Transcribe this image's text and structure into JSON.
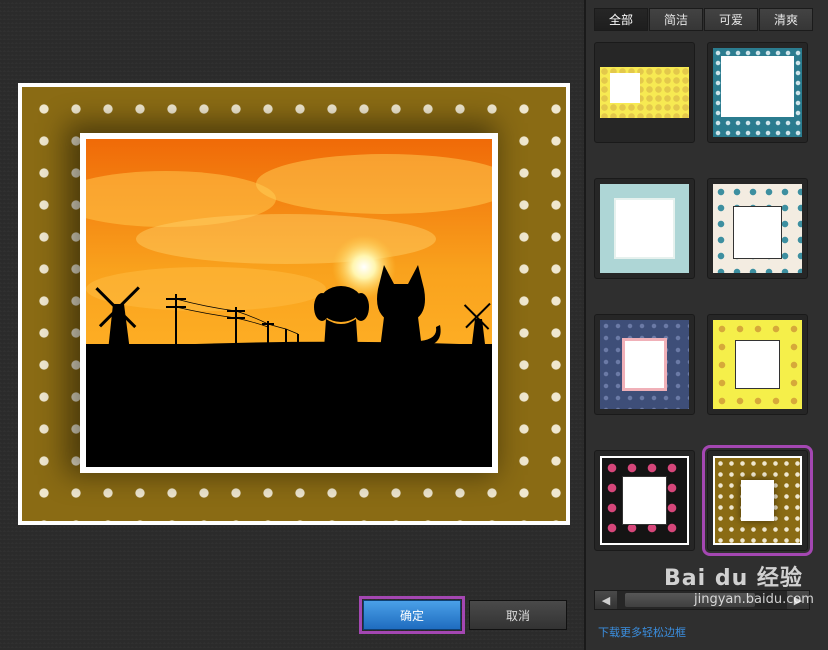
{
  "tabs": [
    {
      "label": "全部",
      "active": true
    },
    {
      "label": "简洁",
      "active": false
    },
    {
      "label": "可爱",
      "active": false
    },
    {
      "label": "清爽",
      "active": false
    }
  ],
  "buttons": {
    "ok": "确定",
    "cancel": "取消"
  },
  "scroll": {
    "left_arrow": "◀",
    "right_arrow": "▶"
  },
  "footer": {
    "download_link": "下载更多轻松边框"
  },
  "watermark": {
    "brand": "Bai du 经验",
    "url": "jingyan.baidu.com"
  },
  "thumbnails": [
    {
      "icon": "yellow-floral-frame"
    },
    {
      "icon": "teal-stars-frame"
    },
    {
      "icon": "mint-simple-frame"
    },
    {
      "icon": "dear-pattern-frame"
    },
    {
      "icon": "navy-denim-frame"
    },
    {
      "icon": "yellow-chick-frame"
    },
    {
      "icon": "black-pink-dots-frame"
    },
    {
      "icon": "gold-polka-dots-frame",
      "selected": true
    }
  ],
  "colors": {
    "accent_selected": "#a447b2",
    "ok_button": "#2f7fd4",
    "frame_gold": "#8a6b14",
    "link": "#3b8fe0"
  }
}
